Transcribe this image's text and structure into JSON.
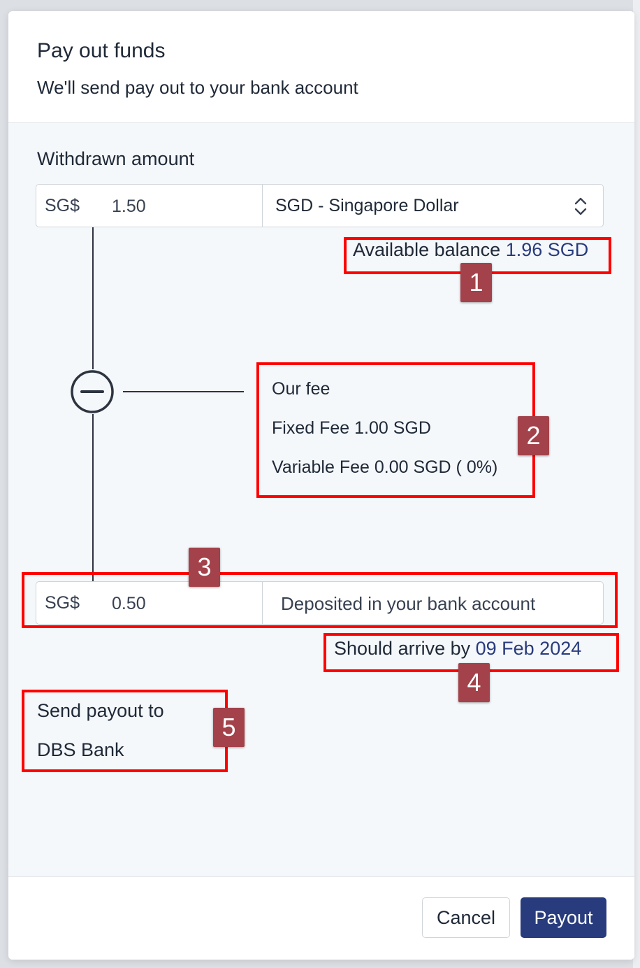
{
  "dialog": {
    "title": "Pay out funds",
    "subtitle": "We'll send pay out to your bank account"
  },
  "withdrawn": {
    "label": "Withdrawn amount",
    "currency_prefix": "SG$",
    "amount": "1.50",
    "currency_select": "SGD - Singapore Dollar"
  },
  "balance": {
    "label": "Available balance",
    "value": "1.96 SGD"
  },
  "fee": {
    "title": "Our fee",
    "fixed": "Fixed Fee 1.00 SGD",
    "variable": "Variable Fee 0.00 SGD ( 0%)"
  },
  "deposit": {
    "currency_prefix": "SG$",
    "amount": "0.50",
    "label": "Deposited in your bank account"
  },
  "arrival": {
    "label": "Should arrive by",
    "date": "09 Feb 2024"
  },
  "payout_target": {
    "label": "Send payout to",
    "bank": "DBS Bank"
  },
  "annotations": {
    "badge_1": "1",
    "badge_2": "2",
    "badge_3": "3",
    "badge_4": "4",
    "badge_5": "5"
  },
  "footer": {
    "cancel_label": "Cancel",
    "payout_label": "Payout"
  },
  "colors": {
    "accent": "#283b7d",
    "highlight": "#ff0000",
    "badge": "#a3424a"
  },
  "icons": {
    "select": "chevron-up-down-icon",
    "subtract": "minus-circle-icon"
  }
}
